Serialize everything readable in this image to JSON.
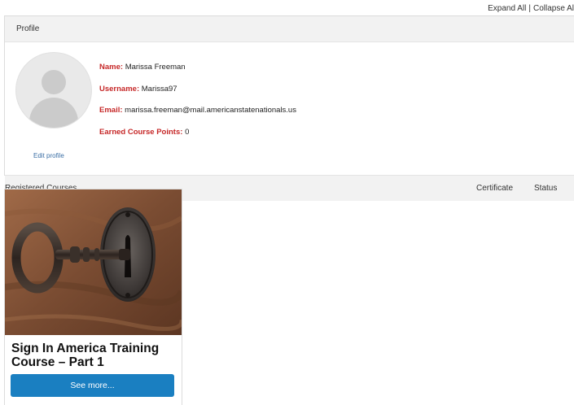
{
  "top_links": {
    "expand_all": "Expand All",
    "separator": "|",
    "collapse_all": "Collapse Al"
  },
  "profile": {
    "header": "Profile",
    "edit_profile": "Edit profile",
    "fields": [
      {
        "label": "Name:",
        "value": "Marissa Freeman"
      },
      {
        "label": "Username:",
        "value": "Marissa97"
      },
      {
        "label": "Email:",
        "value": "marissa.freeman@mail.americanstatenationals.us"
      },
      {
        "label": "Earned Course Points:",
        "value": "0"
      }
    ]
  },
  "courses_table": {
    "registered_courses": "Registered Courses",
    "certificate": "Certificate",
    "status": "Status"
  },
  "course_card": {
    "title": "Sign In America Training Course – Part 1",
    "button": "See more..."
  },
  "colors": {
    "label_red": "#c62828",
    "link_blue": "#3a6ea5",
    "button_blue": "#1a7fc1",
    "header_gray": "#f2f2f2"
  },
  "icons": [
    "avatar-placeholder-icon",
    "key-in-lock-image"
  ]
}
